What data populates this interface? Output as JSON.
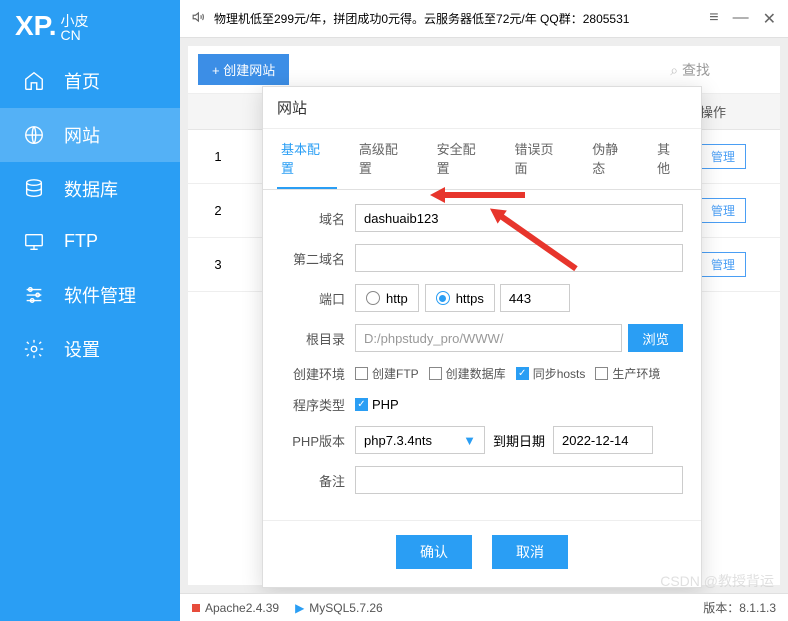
{
  "topBar": {
    "announcement": "物理机低至299元/年，拼团成功0元得。云服务器低至72元/年   QQ群：2805531"
  },
  "sidebar": {
    "logoMain": "XP.",
    "logoSub1": "小皮",
    "logoSub2": "CN",
    "items": [
      {
        "label": "首页"
      },
      {
        "label": "网站"
      },
      {
        "label": "数据库"
      },
      {
        "label": "FTP"
      },
      {
        "label": "软件管理"
      },
      {
        "label": "设置"
      }
    ]
  },
  "toolbar": {
    "create": "+  创建网站",
    "search": "查找"
  },
  "tableRows": [
    "1",
    "2",
    "3"
  ],
  "tableOpHeader": "操作",
  "manageBtn": "管理",
  "modal": {
    "title": "网站",
    "tabs": [
      "基本配置",
      "高级配置",
      "安全配置",
      "错误页面",
      "伪静态",
      "其他"
    ],
    "labels": {
      "domain": "域名",
      "domain2": "第二域名",
      "port": "端口",
      "root": "根目录",
      "env": "创建环境",
      "lang": "程序类型",
      "phpver": "PHP版本",
      "expire": "到期日期",
      "remark": "备注"
    },
    "values": {
      "domain": "dashuaib123",
      "http": "http",
      "https": "https",
      "port": "443",
      "root": "D:/phpstudy_pro/WWW/",
      "browse": "浏览",
      "envFtp": "创建FTP",
      "envDb": "创建数据库",
      "envHosts": "同步hosts",
      "envProd": "生产环境",
      "langPhp": "PHP",
      "phpver": "php7.3.4nts",
      "expire": "2022-12-14"
    },
    "footer": {
      "ok": "确认",
      "cancel": "取消"
    }
  },
  "statusBar": {
    "apache": "Apache2.4.39",
    "mysql": "MySQL5.7.26",
    "version": "版本：8.1.1.3"
  },
  "watermark": "CSDN @教授背运"
}
